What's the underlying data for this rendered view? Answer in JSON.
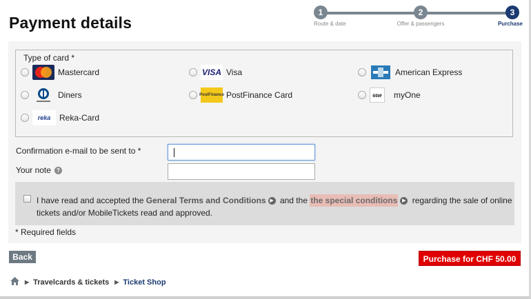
{
  "page": {
    "title": "Payment details"
  },
  "stepper": {
    "steps": [
      {
        "number": "1",
        "label": "Route & date"
      },
      {
        "number": "2",
        "label": "Offer & passengers"
      },
      {
        "number": "3",
        "label": "Purchase"
      }
    ],
    "active_step": 3
  },
  "card_type": {
    "label": "Type of card *",
    "options": [
      {
        "name": "Mastercard",
        "icon": "mastercard-icon"
      },
      {
        "name": "Visa",
        "icon": "visa-icon"
      },
      {
        "name": "American Express",
        "icon": "amex-icon"
      },
      {
        "name": "Diners",
        "icon": "diners-icon"
      },
      {
        "name": "PostFinance Card",
        "icon": "postfinance-icon"
      },
      {
        "name": "myOne",
        "icon": "myone-icon"
      },
      {
        "name": "Reka-Card",
        "icon": "reka-icon"
      }
    ],
    "logo_text": {
      "visa": "VISA",
      "reka": "reka",
      "postfinance": "PostFinance",
      "myone": "one"
    }
  },
  "email": {
    "label": "Confirmation e-mail to be sent to *",
    "value": ""
  },
  "note": {
    "label": "Your note",
    "value": "",
    "help_icon": "?"
  },
  "terms": {
    "text_1": "I have read and accepted the",
    "link_1": "General Terms and Conditions",
    "text_2": "and the",
    "link_2": "the special conditions",
    "text_3": "regarding the sale of online tickets and/or MobileTickets read and approved.",
    "checked": false
  },
  "required_note": "* Required fields",
  "buttons": {
    "back": "Back",
    "purchase": "Purchase for CHF 50.00"
  },
  "breadcrumb": {
    "items": [
      "Travelcards & tickets",
      "Ticket Shop"
    ]
  },
  "colors": {
    "accent": "#1a3a70",
    "purchase": "#e00000",
    "highlight": "#e8bdb5"
  }
}
